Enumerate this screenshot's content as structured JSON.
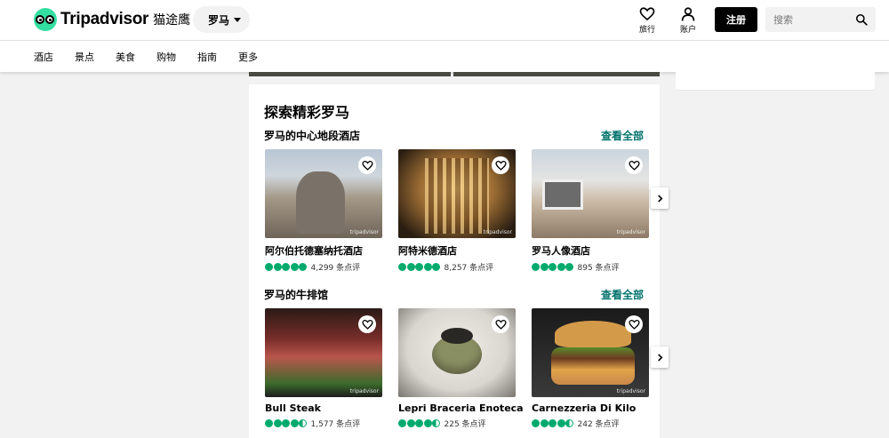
{
  "header": {
    "brand": "Tripadvisor",
    "brand_cn": "猫途鹰",
    "geo": "罗马",
    "trips_label": "旅行",
    "account_label": "账户",
    "signup_label": "注册",
    "search_placeholder": "搜索"
  },
  "nav": {
    "items": [
      {
        "label": "酒店"
      },
      {
        "label": "景点"
      },
      {
        "label": "美食"
      },
      {
        "label": "购物"
      },
      {
        "label": "指南"
      },
      {
        "label": "更多"
      }
    ]
  },
  "explore": {
    "title": "探索精彩罗马",
    "sections": [
      {
        "title": "罗马的中心地段酒店",
        "see_all": "查看全部",
        "cards": [
          {
            "name": "阿尔伯托德塞纳托酒店",
            "rating": 5,
            "reviews": "4,299 条点评",
            "watermark": "tripadvisor"
          },
          {
            "name": "阿特米德酒店",
            "rating": 5,
            "reviews": "8,257 条点评",
            "watermark": "tripadvisor"
          },
          {
            "name": "罗马人像酒店",
            "rating": 5,
            "reviews": "895 条点评",
            "watermark": "tripadvisor"
          }
        ]
      },
      {
        "title": "罗马的牛排馆",
        "see_all": "查看全部",
        "cards": [
          {
            "name": "Bull Steak",
            "rating": 4.5,
            "reviews": "1,577 条点评",
            "watermark": "tripadvisor"
          },
          {
            "name": "Lepri Braceria Enoteca",
            "rating": 4.5,
            "reviews": "225 条点评",
            "watermark": "tripadvisor"
          },
          {
            "name": "Carnezzeria Di Kilo",
            "rating": 4.5,
            "reviews": "242 条点评",
            "watermark": "tripadvisor"
          }
        ]
      }
    ]
  },
  "colors": {
    "brand_green": "#34e0a1",
    "bubble_green": "#00aa6c",
    "link_green": "#00726b"
  },
  "icons": [
    "heart-icon",
    "user-icon",
    "search-icon",
    "chevron-right-icon",
    "chevron-down-icon"
  ]
}
